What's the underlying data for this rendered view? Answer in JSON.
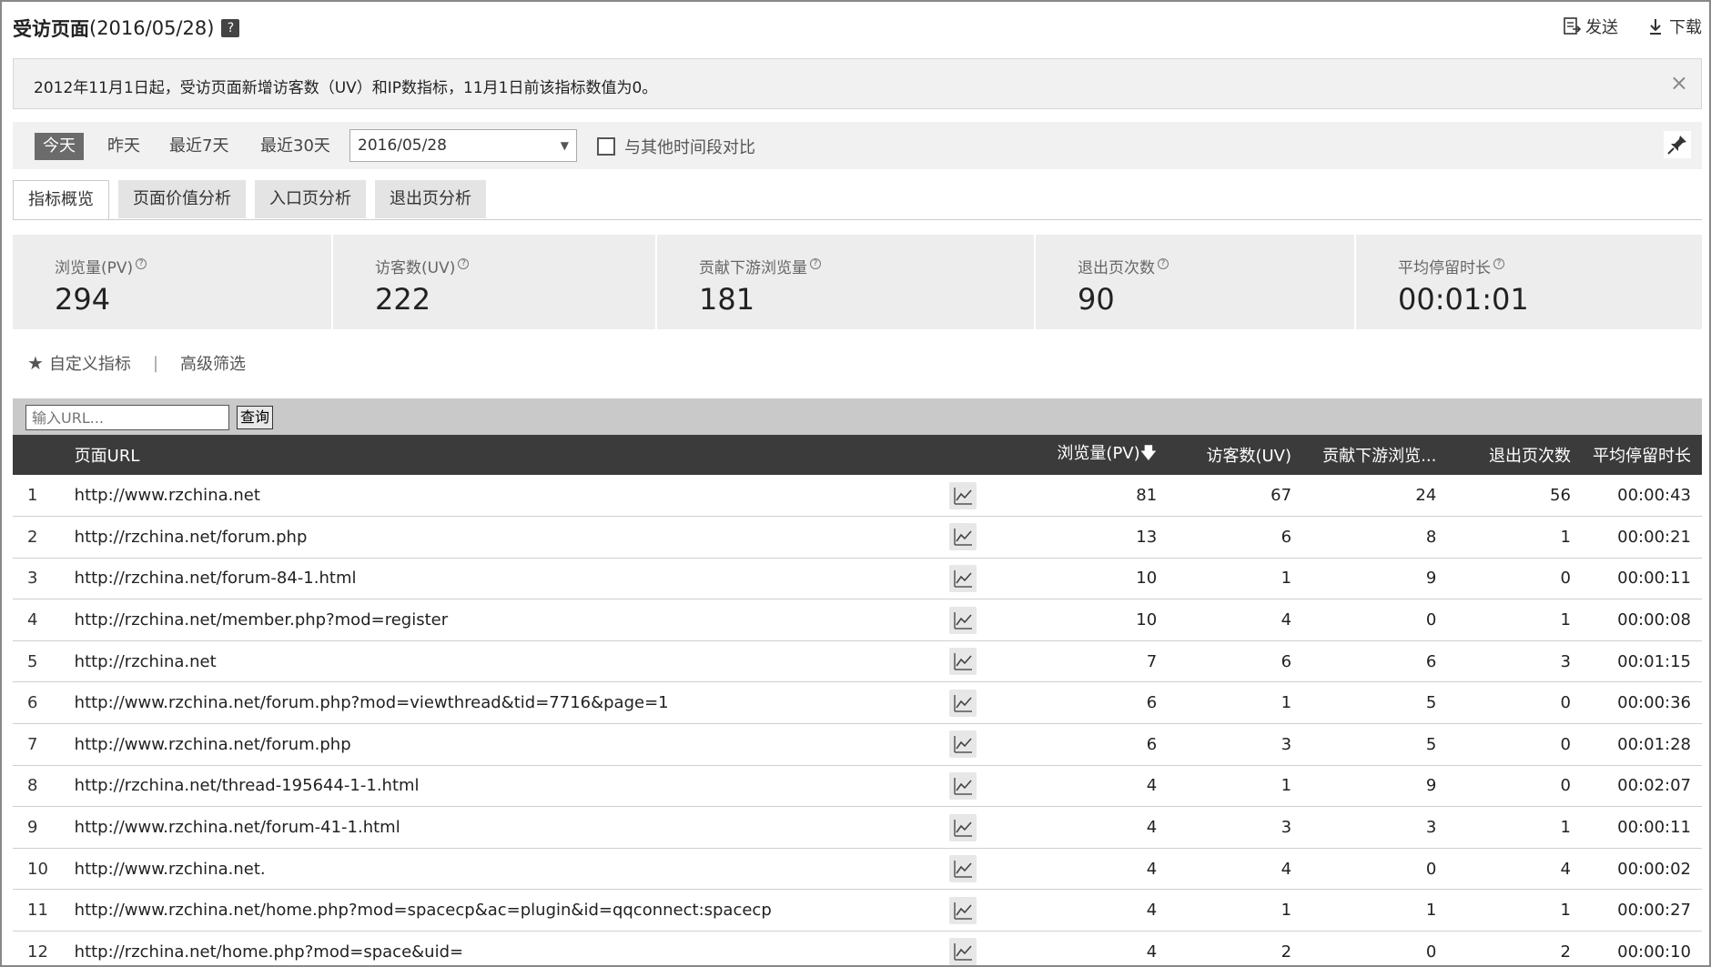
{
  "header": {
    "title": "受访页面",
    "date": "(2016/05/28)",
    "help_glyph": "?",
    "send_label": "发送",
    "download_label": "下载"
  },
  "notice": {
    "text": "2012年11月1日起，受访页面新增访客数（UV）和IP数指标，11月1日前该指标数值为0。",
    "close": "×"
  },
  "datebar": {
    "today": "今天",
    "yesterday": "昨天",
    "last7": "最近7天",
    "last30": "最近30天",
    "selected_date": "2016/05/28",
    "compare_label": "与其他时间段对比"
  },
  "tabs": [
    {
      "label": "指标概览",
      "active": true
    },
    {
      "label": "页面价值分析",
      "active": false
    },
    {
      "label": "入口页分析",
      "active": false
    },
    {
      "label": "退出页分析",
      "active": false
    }
  ],
  "kpis": [
    {
      "label": "浏览量(PV)",
      "value": "294"
    },
    {
      "label": "访客数(UV)",
      "value": "222"
    },
    {
      "label": "贡献下游浏览量",
      "value": "181"
    },
    {
      "label": "退出页次数",
      "value": "90"
    },
    {
      "label": "平均停留时长",
      "value": "00:01:01"
    }
  ],
  "filters": {
    "custom_metrics": "自定义指标",
    "separator": "|",
    "advanced_filter": "高级筛选"
  },
  "search": {
    "placeholder": "输入URL...",
    "button": "查询"
  },
  "table": {
    "headers": {
      "url": "页面URL",
      "pv": "浏览量(PV)",
      "uv": "访客数(UV)",
      "downstream": "贡献下游浏览...",
      "exits": "退出页次数",
      "avg_time": "平均停留时长"
    },
    "sort_indicator": "down-arrow-icon",
    "rows": [
      {
        "idx": "1",
        "url": "http://www.rzchina.net",
        "pv": "81",
        "uv": "67",
        "down": "24",
        "exits": "56",
        "avg": "00:00:43"
      },
      {
        "idx": "2",
        "url": "http://rzchina.net/forum.php",
        "pv": "13",
        "uv": "6",
        "down": "8",
        "exits": "1",
        "avg": "00:00:21"
      },
      {
        "idx": "3",
        "url": "http://rzchina.net/forum-84-1.html",
        "pv": "10",
        "uv": "1",
        "down": "9",
        "exits": "0",
        "avg": "00:00:11"
      },
      {
        "idx": "4",
        "url": "http://rzchina.net/member.php?mod=register",
        "pv": "10",
        "uv": "4",
        "down": "0",
        "exits": "1",
        "avg": "00:00:08"
      },
      {
        "idx": "5",
        "url": "http://rzchina.net",
        "pv": "7",
        "uv": "6",
        "down": "6",
        "exits": "3",
        "avg": "00:01:15"
      },
      {
        "idx": "6",
        "url": "http://www.rzchina.net/forum.php?mod=viewthread&tid=7716&page=1",
        "pv": "6",
        "uv": "1",
        "down": "5",
        "exits": "0",
        "avg": "00:00:36"
      },
      {
        "idx": "7",
        "url": "http://www.rzchina.net/forum.php",
        "pv": "6",
        "uv": "3",
        "down": "5",
        "exits": "0",
        "avg": "00:01:28"
      },
      {
        "idx": "8",
        "url": "http://rzchina.net/thread-195644-1-1.html",
        "pv": "4",
        "uv": "1",
        "down": "9",
        "exits": "0",
        "avg": "00:02:07"
      },
      {
        "idx": "9",
        "url": "http://www.rzchina.net/forum-41-1.html",
        "pv": "4",
        "uv": "3",
        "down": "3",
        "exits": "1",
        "avg": "00:00:11"
      },
      {
        "idx": "10",
        "url": "http://www.rzchina.net.",
        "pv": "4",
        "uv": "4",
        "down": "0",
        "exits": "4",
        "avg": "00:00:02"
      },
      {
        "idx": "11",
        "url": "http://www.rzchina.net/home.php?mod=spacecp&ac=plugin&id=qqconnect:spacecp",
        "pv": "4",
        "uv": "1",
        "down": "1",
        "exits": "1",
        "avg": "00:00:27"
      },
      {
        "idx": "12",
        "url": "http://rzchina.net/home.php?mod=space&uid=",
        "pv": "4",
        "uv": "2",
        "down": "0",
        "exits": "2",
        "avg": "00:00:10"
      }
    ]
  }
}
